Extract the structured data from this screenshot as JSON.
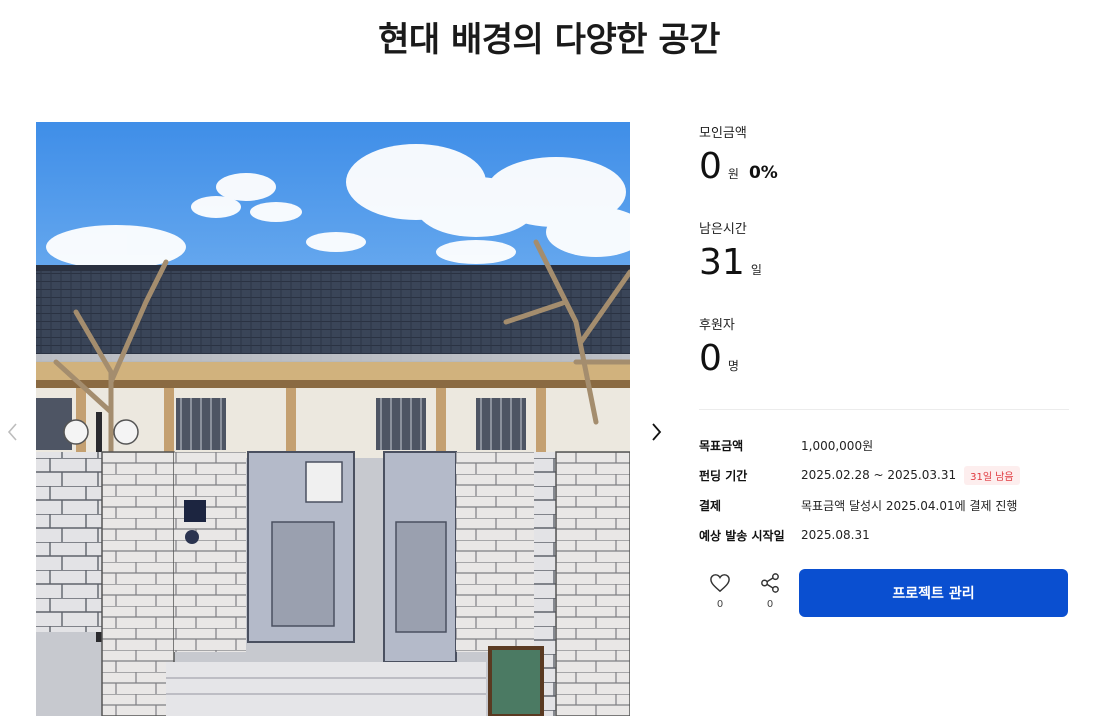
{
  "page": {
    "title": "현대 배경의 다양한 공간"
  },
  "gallery": {
    "image_alt": "한옥 대문 배경 이미지"
  },
  "stats": {
    "raised": {
      "label": "모인금액",
      "value": "0",
      "unit": "원",
      "percent": "0%"
    },
    "remaining": {
      "label": "남은시간",
      "value": "31",
      "unit": "일"
    },
    "backers": {
      "label": "후원자",
      "value": "0",
      "unit": "명"
    }
  },
  "details": [
    {
      "label": "목표금액",
      "value": "1,000,000원",
      "badge": ""
    },
    {
      "label": "펀딩 기간",
      "value": "2025.02.28 ~ 2025.03.31",
      "badge": "31일 남음"
    },
    {
      "label": "결제",
      "value": "목표금액 달성시 2025.04.01에 결제 진행",
      "badge": ""
    },
    {
      "label": "예상 발송 시작일",
      "value": "2025.08.31",
      "badge": ""
    }
  ],
  "actions": {
    "like_count": "0",
    "share_count": "0",
    "manage_label": "프로젝트 관리"
  },
  "colors": {
    "primary": "#0a4fd0",
    "badge_text": "#e0383e",
    "badge_bg": "#fdeeee"
  }
}
